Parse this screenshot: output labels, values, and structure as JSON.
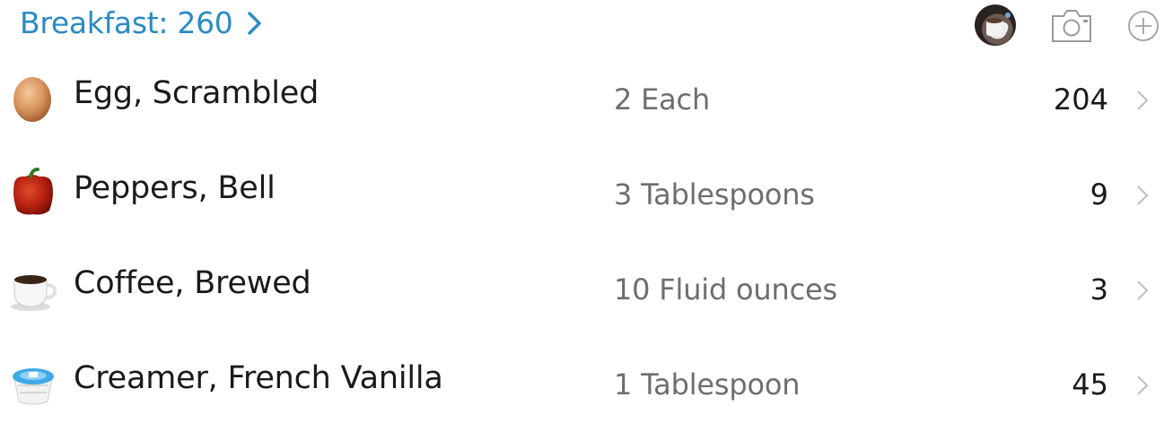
{
  "header": {
    "meal_label": "Breakfast: 260",
    "photo_icon": "meal-photo-thumbnail",
    "camera_icon": "camera-icon",
    "add_icon": "plus-circle-icon",
    "accent_color": "#2b8ac4"
  },
  "entries": [
    {
      "name": "Egg, Scrambled",
      "serving": "2 Each",
      "calories": "204",
      "icon": "egg-icon"
    },
    {
      "name": "Peppers, Bell",
      "serving": "3 Tablespoons",
      "calories": "9",
      "icon": "bell-pepper-icon"
    },
    {
      "name": "Coffee, Brewed",
      "serving": "10 Fluid ounces",
      "calories": "3",
      "icon": "coffee-cup-icon"
    },
    {
      "name": "Creamer, French Vanilla",
      "serving": "1 Tablespoon",
      "calories": "45",
      "icon": "creamer-cup-icon"
    }
  ]
}
